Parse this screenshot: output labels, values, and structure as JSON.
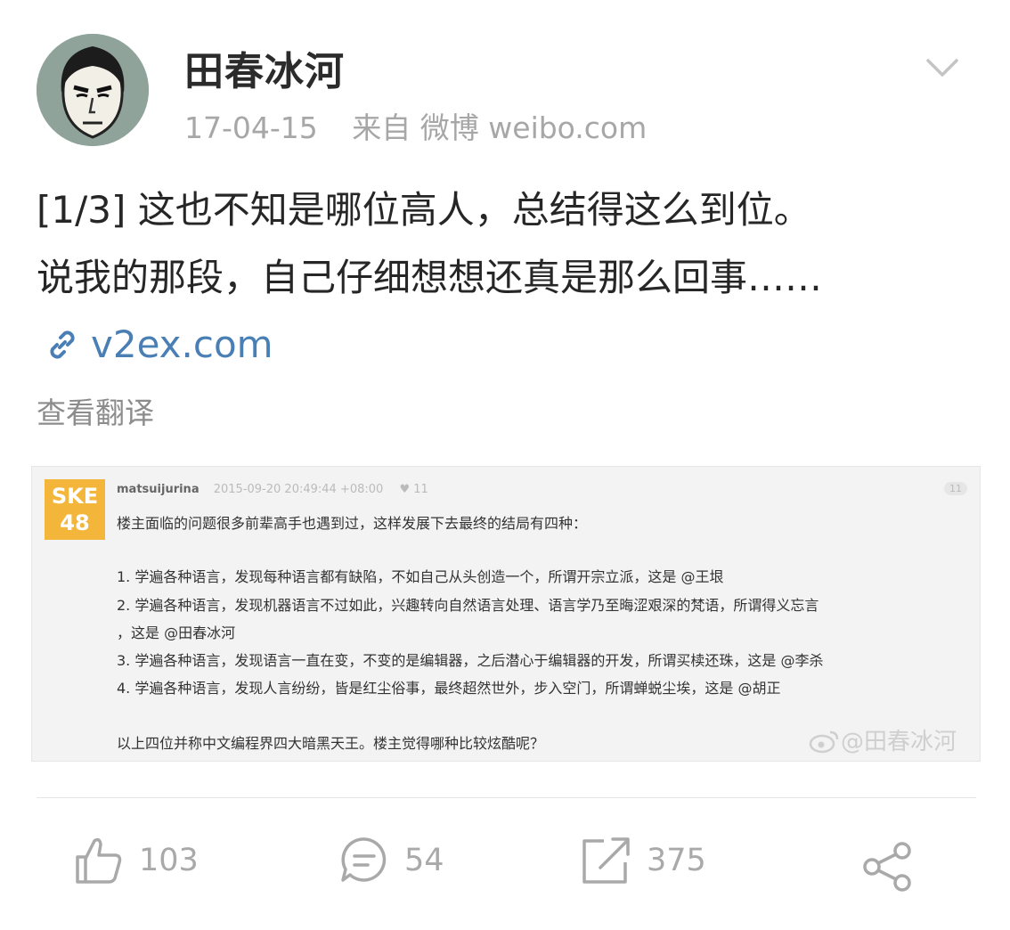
{
  "post": {
    "author": "田春冰河",
    "date": "17-04-15",
    "source": "来自 微博 weibo.com",
    "text_line1": "[1/3] 这也不知是哪位高人，总结得这么到位。",
    "text_line2": "说我的那段，自己仔细想想还真是那么回事……",
    "link_icon": "link-icon",
    "link_text": "v2ex.com",
    "translate": "查看翻译"
  },
  "screenshot": {
    "logo_text_1": "SKE",
    "logo_text_2": "48",
    "username": "matsuijurina",
    "timestamp": "2015-09-20 20:49:44 +08:00",
    "likes": "♥ 11",
    "floor": "11",
    "lines": [
      "楼主面临的问题很多前辈高手也遇到过，这样发展下去最终的结局有四种：",
      "1. 学遍各种语言，发现每种语言都有缺陷，不如自己从头创造一个，所谓开宗立派，这是 @王垠",
      "2. 学遍各种语言，发现机器语言不过如此，兴趣转向自然语言处理、语言学乃至晦涩艰深的梵语，所谓得义忘言",
      "，这是 @田春冰河",
      "3. 学遍各种语言，发现语言一直在变，不变的是编辑器，之后潜心于编辑器的开发，所谓买椟还珠，这是 @李杀",
      "4. 学遍各种语言，发现人言纷纷，皆是红尘俗事，最终超然世外，步入空门，所谓蝉蜕尘埃，这是 @胡正",
      "以上四位并称中文编程界四大暗黑天王。楼主觉得哪种比较炫酷呢？"
    ],
    "watermark": "@田春冰河"
  },
  "actions": {
    "like_count": "103",
    "comment_count": "54",
    "repost_count": "375"
  },
  "colors": {
    "link": "#4a7fb5",
    "muted": "#a7a7a7",
    "logo": "#f4b63a"
  }
}
